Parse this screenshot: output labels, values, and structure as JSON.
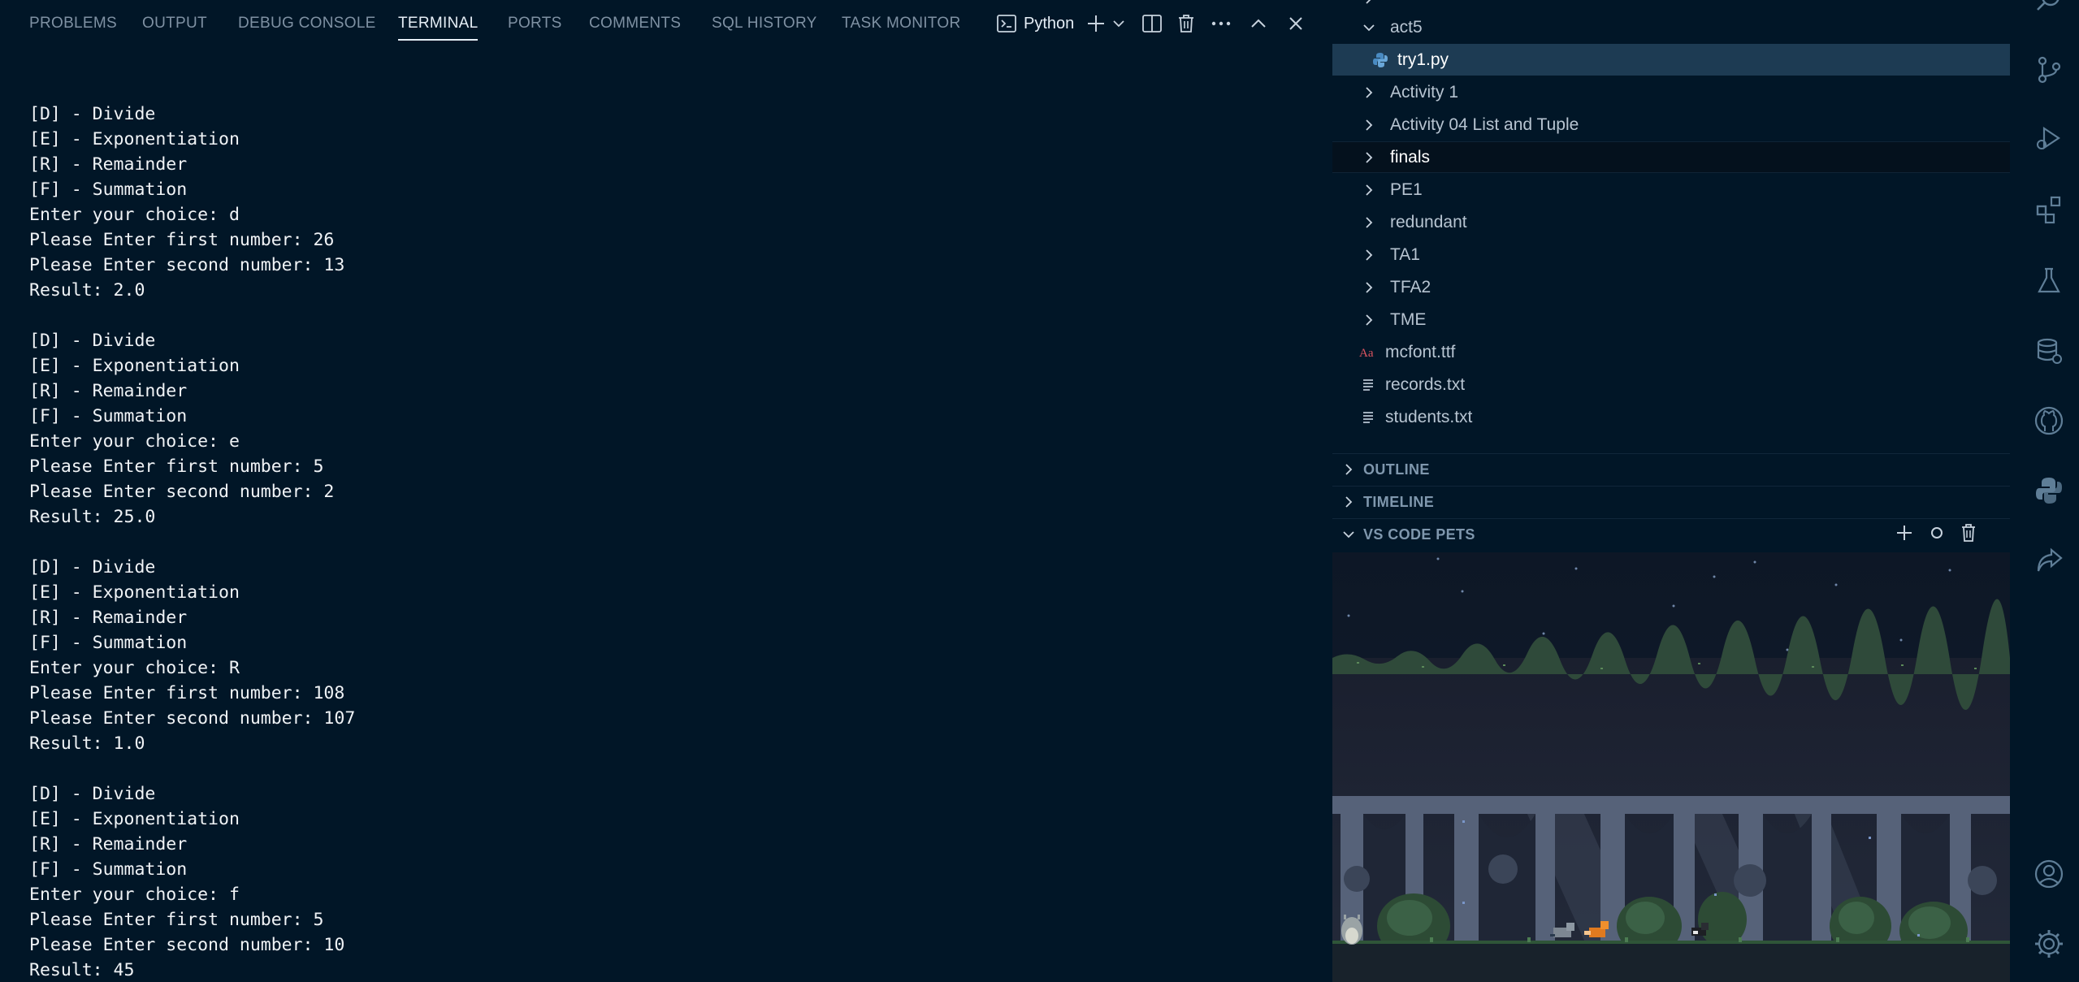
{
  "panel": {
    "tabs": [
      {
        "label": "PROBLEMS",
        "active": false
      },
      {
        "label": "OUTPUT",
        "active": false
      },
      {
        "label": "DEBUG CONSOLE",
        "active": false
      },
      {
        "label": "TERMINAL",
        "active": true
      },
      {
        "label": "PORTS",
        "active": false
      },
      {
        "label": "COMMENTS",
        "active": false
      },
      {
        "label": "SQL HISTORY",
        "active": false
      },
      {
        "label": "TASK MONITOR",
        "active": false
      }
    ],
    "terminal_name": "Python",
    "actions": [
      "terminal-icon",
      "add-icon",
      "chevron-down-icon",
      "split-icon",
      "trash-icon",
      "more-icon",
      "maximize-icon",
      "close-icon"
    ]
  },
  "terminal": {
    "lines": [
      "[D] - Divide",
      "[E] - Exponentiation",
      "[R] - Remainder",
      "[F] - Summation",
      "Enter your choice: d",
      "Please Enter first number: 26",
      "Please Enter second number: 13",
      "Result: 2.0",
      "",
      "[D] - Divide",
      "[E] - Exponentiation",
      "[R] - Remainder",
      "[F] - Summation",
      "Enter your choice: e",
      "Please Enter first number: 5",
      "Please Enter second number: 2",
      "Result: 25.0",
      "",
      "[D] - Divide",
      "[E] - Exponentiation",
      "[R] - Remainder",
      "[F] - Summation",
      "Enter your choice: R",
      "Please Enter first number: 108",
      "Please Enter second number: 107",
      "Result: 1.0",
      "",
      "[D] - Divide",
      "[E] - Exponentiation",
      "[R] - Remainder",
      "[F] - Summation",
      "Enter your choice: f",
      "Please Enter first number: 5",
      "Please Enter second number: 10",
      "Result: 45"
    ]
  },
  "explorer": {
    "items": [
      {
        "label": "act5",
        "kind": "folder-open",
        "icon": "chevron-down-icon"
      },
      {
        "label": "try1.py",
        "kind": "file",
        "icon": "python-icon",
        "selected": true
      },
      {
        "label": "Activity 1",
        "kind": "folder",
        "icon": "chevron-right-icon"
      },
      {
        "label": "Activity 04 List and Tuple",
        "kind": "folder",
        "icon": "chevron-right-icon"
      },
      {
        "label": "finals",
        "kind": "folder",
        "icon": "chevron-right-icon",
        "hover": true
      },
      {
        "label": "PE1",
        "kind": "folder",
        "icon": "chevron-right-icon"
      },
      {
        "label": "redundant",
        "kind": "folder",
        "icon": "chevron-right-icon"
      },
      {
        "label": "TA1",
        "kind": "folder",
        "icon": "chevron-right-icon"
      },
      {
        "label": "TFA2",
        "kind": "folder",
        "icon": "chevron-right-icon"
      },
      {
        "label": "TME",
        "kind": "folder",
        "icon": "chevron-right-icon"
      },
      {
        "label": "mcfont.ttf",
        "kind": "file",
        "icon": "font-file-icon"
      },
      {
        "label": "records.txt",
        "kind": "file",
        "icon": "text-file-icon"
      },
      {
        "label": "students.txt",
        "kind": "file",
        "icon": "text-file-icon"
      }
    ],
    "sections": [
      {
        "label": "OUTLINE",
        "expanded": false
      },
      {
        "label": "TIMELINE",
        "expanded": false
      },
      {
        "label": "VS CODE PETS",
        "expanded": true
      }
    ],
    "pets_actions": [
      "add-pet-icon",
      "ball-icon",
      "remove-pet-icon"
    ]
  },
  "activity_bar": {
    "top": [
      "search-icon",
      "source-control-icon",
      "run-debug-icon",
      "extensions-icon",
      "testing-icon",
      "database-icon",
      "github-icon",
      "python-icon",
      "remote-icon"
    ],
    "bottom": [
      "account-icon",
      "settings-icon"
    ]
  },
  "colors": {
    "background": "#011627",
    "selected_row": "#1d3b53",
    "terminal_text": "#f0f3f6",
    "muted": "#7f91a3"
  }
}
